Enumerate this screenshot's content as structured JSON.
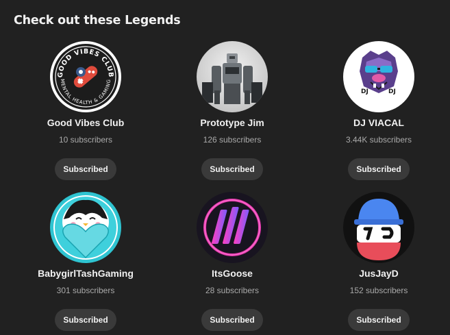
{
  "section": {
    "title": "Check out these Legends"
  },
  "channels": [
    {
      "name": "Good Vibes Club",
      "subscribers": "10 subscribers",
      "button": "Subscribed",
      "avatar_icon": "good-vibes-club-logo",
      "avatar_text_top": "GOOD VIBES CLUB",
      "avatar_text_bottom": "MENTAL HEALTH & GAMING"
    },
    {
      "name": "Prototype Jim",
      "subscribers": "126 subscribers",
      "button": "Subscribed",
      "avatar_icon": "mech-robot-photo"
    },
    {
      "name": "DJ VIACAL",
      "subscribers": "3.44K subscribers",
      "button": "Subscribed",
      "avatar_icon": "dj-bulldog-logo",
      "avatar_text": "DJ"
    },
    {
      "name": "BabygirlTashGaming",
      "subscribers": "301 subscribers",
      "button": "Subscribed",
      "avatar_icon": "penguin-heart-avatar"
    },
    {
      "name": "ItsGoose",
      "subscribers": "28 subscribers",
      "button": "Subscribed",
      "avatar_icon": "neon-bars-logo"
    },
    {
      "name": "JusJayD",
      "subscribers": "152 subscribers",
      "button": "Subscribed",
      "avatar_icon": "blue-cap-sunglasses-face"
    }
  ]
}
